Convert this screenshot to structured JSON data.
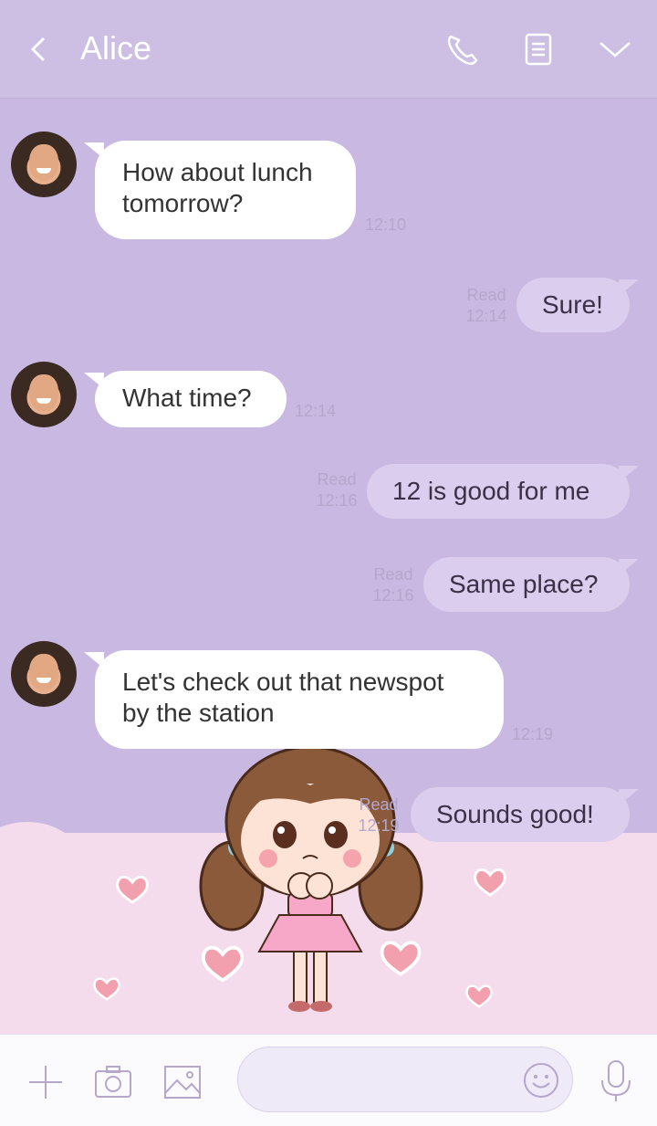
{
  "header": {
    "title": "Alice",
    "icons": [
      "back-icon",
      "phone-icon",
      "notes-icon",
      "chevron-down-icon"
    ]
  },
  "messages": [
    {
      "side": "left",
      "text": "How about lunch tomorrow?",
      "time": "12:10"
    },
    {
      "side": "right",
      "text": "Sure!",
      "read": "Read",
      "time": "12:14"
    },
    {
      "side": "left",
      "text": "What time?",
      "time": "12:14"
    },
    {
      "side": "right",
      "text": "12 is good for me",
      "read": "Read",
      "time": "12:16"
    },
    {
      "side": "right",
      "text": "Same place?",
      "read": "Read",
      "time": "12:16"
    },
    {
      "side": "left",
      "text": "Let's check out that newspot by the station",
      "time": "12:19"
    },
    {
      "side": "right",
      "text": "Sounds good!",
      "read": "Read",
      "time": "12:19"
    }
  ],
  "toolbar": {
    "icons": [
      "plus-icon",
      "camera-icon",
      "image-icon",
      "emoji-icon",
      "microphone-icon"
    ],
    "input_value": ""
  },
  "colors": {
    "background": "#c9b9e2",
    "header": "#cdbfe4",
    "sent_bubble": "#dacdee",
    "received_bubble": "#ffffff",
    "meta_text": "#b5a6cc",
    "ground": "#f4dced"
  }
}
